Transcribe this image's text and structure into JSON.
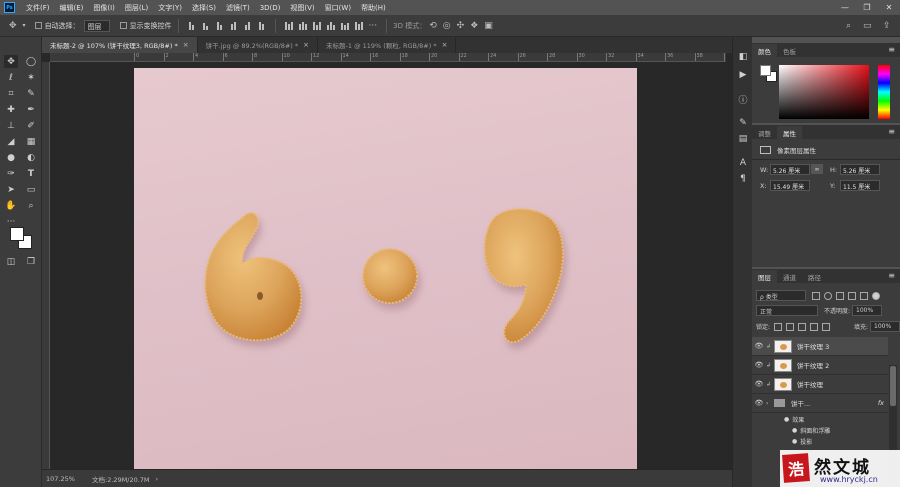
{
  "menubar": {
    "logo": "Ps",
    "items": [
      "文件(F)",
      "编辑(E)",
      "图像(I)",
      "图层(L)",
      "文字(Y)",
      "选择(S)",
      "滤镜(T)",
      "3D(D)",
      "视图(V)",
      "窗口(W)",
      "帮助(H)"
    ],
    "window_controls": [
      "—",
      "❐",
      "✕"
    ]
  },
  "options": {
    "move_icon": "move-tool-icon",
    "auto_select_label": "自动选择：",
    "auto_select_value": "图层",
    "show_transform_label": "显示变换控件",
    "mode_3d_label": "3D 模式："
  },
  "tabs": [
    {
      "label": "未标题-2 @ 107% (饼干纹理3, RGB/8#) *",
      "close": "×"
    },
    {
      "label": "饼干.jpg @ 89.2%(RGB/8#) *",
      "close": "×"
    },
    {
      "label": "未标题-1 @ 119% (颗粒, RGB/8#) *",
      "close": "×"
    }
  ],
  "ruler": {
    "ticks": [
      "0",
      "2",
      "4",
      "6",
      "8",
      "10",
      "12",
      "14",
      "16",
      "18",
      "20",
      "22",
      "24",
      "26",
      "28",
      "30",
      "32",
      "34",
      "36",
      "38",
      "40",
      "42",
      "44",
      "46"
    ]
  },
  "status": {
    "zoom": "107.25%",
    "doc_size": "文档:2.29M/20.7M",
    "arrow": "›"
  },
  "color_panel": {
    "tabs": [
      "颜色",
      "色板"
    ],
    "menu": "≡",
    "foreground": "#ffffff",
    "background": "#ffffff"
  },
  "properties": {
    "tabs": [
      "调整",
      "属性"
    ],
    "menu": "≡",
    "type_label": "像素图层属性",
    "w_label": "W:",
    "w_value": "5.26 厘米",
    "h_label": "H:",
    "h_value": "5.26 厘米",
    "x_label": "X:",
    "x_value": "15.49 厘米",
    "y_label": "Y:",
    "y_value": "11.5 厘米",
    "link_icon": "∞"
  },
  "layers_panel": {
    "tabs": [
      "图层",
      "通道",
      "路径"
    ],
    "menu": "≡",
    "filter_value": "ρ 类型",
    "blend_mode": "正常",
    "opacity_label": "不透明度:",
    "opacity_value": "100%",
    "lock_label": "锁定:",
    "fill_label": "填充:",
    "fill_value": "100%",
    "layers": [
      {
        "name": "饼干纹理 3",
        "eye": "👁",
        "selected": true
      },
      {
        "name": "饼干纹理 2",
        "eye": "👁",
        "selected": false
      },
      {
        "name": "饼干纹理",
        "eye": "👁",
        "selected": false
      }
    ],
    "group": {
      "name": "饼干...",
      "fx": "fx"
    },
    "effects_label": "效果",
    "effects": [
      "斜面和浮雕",
      "投影"
    ]
  },
  "watermark": {
    "seal": "浩",
    "title": "然文城",
    "url": "www.hryckj.cn"
  },
  "colors": {
    "accent": "#31a8ff",
    "canvas": "#e2c3ca",
    "biscuit": "#dca35a"
  }
}
